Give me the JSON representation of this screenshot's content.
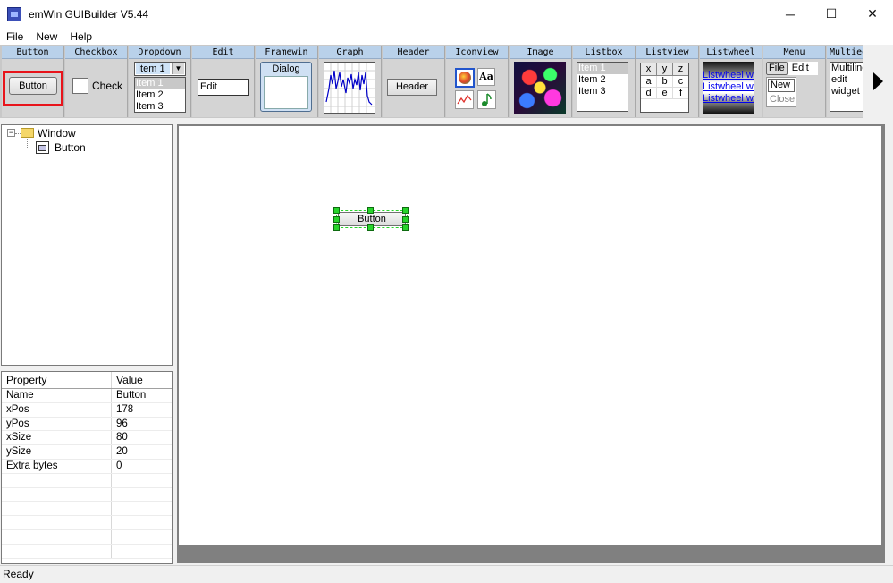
{
  "window": {
    "title": "emWin GUIBuilder V5.44",
    "minimize_glyph": "─",
    "maximize_glyph": "☐",
    "close_glyph": "✕"
  },
  "menubar": [
    "File",
    "New",
    "Help"
  ],
  "toolbar": {
    "tools": [
      {
        "header": "Button",
        "label": "Button"
      },
      {
        "header": "Checkbox",
        "label": "Check"
      },
      {
        "header": "Dropdown",
        "selected": "Item 1",
        "items": [
          "Item 1",
          "Item 2",
          "Item 3"
        ]
      },
      {
        "header": "Edit",
        "value": "Edit"
      },
      {
        "header": "Framewin",
        "title": "Dialog"
      },
      {
        "header": "Graph"
      },
      {
        "header": "Header",
        "label": "Header"
      },
      {
        "header": "Iconview",
        "aa": "Aa"
      },
      {
        "header": "Image"
      },
      {
        "header": "Listbox",
        "items": [
          "Item 1",
          "Item 2",
          "Item 3"
        ]
      },
      {
        "header": "Listview",
        "cols": [
          "x",
          "y",
          "z"
        ],
        "rows": [
          [
            "a",
            "b",
            "c"
          ],
          [
            "d",
            "e",
            "f"
          ]
        ]
      },
      {
        "header": "Listwheel",
        "items": [
          "Listwheel wid",
          "Listwheel wid",
          "Listwheel wid"
        ]
      },
      {
        "header": "Menu",
        "items": [
          "File",
          "Edit",
          "New",
          "Close"
        ]
      },
      {
        "header": "Multiedit",
        "lines": [
          "Multiline",
          "edit",
          "widget"
        ]
      }
    ]
  },
  "tree": {
    "root": "Window",
    "child": "Button",
    "expander": "−"
  },
  "properties": {
    "headers": [
      "Property",
      "Value"
    ],
    "rows": [
      [
        "Name",
        "Button"
      ],
      [
        "xPos",
        "178"
      ],
      [
        "yPos",
        "96"
      ],
      [
        "xSize",
        "80"
      ],
      [
        "ySize",
        "20"
      ],
      [
        "Extra bytes",
        "0"
      ],
      [
        "",
        ""
      ],
      [
        "",
        ""
      ],
      [
        "",
        ""
      ],
      [
        "",
        ""
      ],
      [
        "",
        ""
      ],
      [
        "",
        ""
      ]
    ]
  },
  "canvas": {
    "button_label": "Button"
  },
  "status": "Ready",
  "colors": {
    "selection": "#e8141b",
    "handle": "#27d42b",
    "tool_header": "#b9d1ea",
    "listwheel_text": "#0000ee"
  }
}
